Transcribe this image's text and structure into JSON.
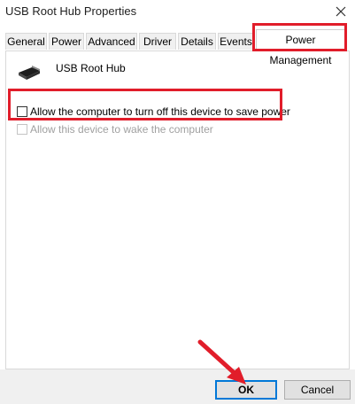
{
  "window": {
    "title": "USB Root Hub Properties",
    "close_glyph": "×"
  },
  "tabs": [
    {
      "label": "General"
    },
    {
      "label": "Power"
    },
    {
      "label": "Advanced"
    },
    {
      "label": "Driver"
    },
    {
      "label": "Details"
    },
    {
      "label": "Events"
    },
    {
      "label": "Power Management",
      "active": true
    }
  ],
  "device": {
    "icon": "usb-connector-icon",
    "name": "USB Root Hub"
  },
  "options": [
    {
      "label": "Allow the computer to turn off this device to save power",
      "checked": false,
      "enabled": true
    },
    {
      "label": "Allow this device to wake the computer",
      "checked": false,
      "enabled": false
    }
  ],
  "buttons": {
    "ok": "OK",
    "cancel": "Cancel"
  },
  "colors": {
    "highlight": "#e11d2a",
    "accent": "#0078d7",
    "disabled_text": "#a0a0a0"
  }
}
